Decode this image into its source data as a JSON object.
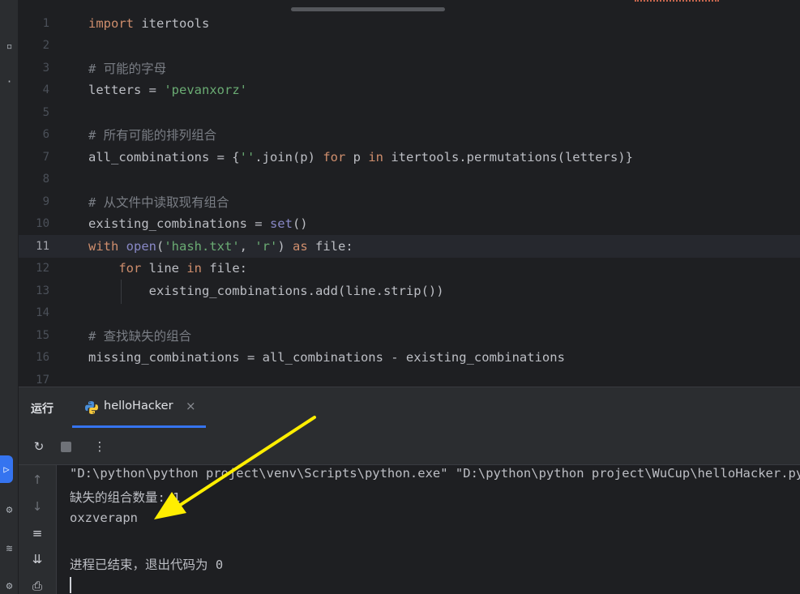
{
  "editor": {
    "lines": [
      {
        "n": "1",
        "segs": [
          {
            "c": "kw",
            "t": "import"
          },
          {
            "c": "",
            "t": " itertools"
          }
        ]
      },
      {
        "n": "2",
        "segs": []
      },
      {
        "n": "3",
        "segs": [
          {
            "c": "cmt",
            "t": "# 可能的字母"
          }
        ]
      },
      {
        "n": "4",
        "segs": [
          {
            "c": "",
            "t": "letters = "
          },
          {
            "c": "str",
            "t": "'pevanxorz'"
          }
        ]
      },
      {
        "n": "5",
        "segs": []
      },
      {
        "n": "6",
        "segs": [
          {
            "c": "cmt",
            "t": "# 所有可能的排列组合"
          }
        ]
      },
      {
        "n": "7",
        "segs": [
          {
            "c": "",
            "t": "all_combinations = {"
          },
          {
            "c": "str",
            "t": "''"
          },
          {
            "c": "",
            "t": ".join(p) "
          },
          {
            "c": "kw",
            "t": "for"
          },
          {
            "c": "",
            "t": " p "
          },
          {
            "c": "kw",
            "t": "in"
          },
          {
            "c": "",
            "t": " itertools.permutations(letters)}"
          }
        ]
      },
      {
        "n": "8",
        "segs": []
      },
      {
        "n": "9",
        "segs": [
          {
            "c": "cmt",
            "t": "# 从文件中读取现有组合"
          }
        ]
      },
      {
        "n": "10",
        "segs": [
          {
            "c": "",
            "t": "existing_combinations = "
          },
          {
            "c": "bi",
            "t": "set"
          },
          {
            "c": "",
            "t": "()"
          }
        ]
      },
      {
        "n": "11",
        "segs": [
          {
            "c": "kw",
            "t": "with"
          },
          {
            "c": "",
            "t": " "
          },
          {
            "c": "bi",
            "t": "open"
          },
          {
            "c": "",
            "t": "("
          },
          {
            "c": "str",
            "t": "'hash.txt'"
          },
          {
            "c": "",
            "t": ", "
          },
          {
            "c": "str",
            "t": "'r'"
          },
          {
            "c": "",
            "t": ") "
          },
          {
            "c": "kw",
            "t": "as"
          },
          {
            "c": "",
            "t": " file:"
          }
        ]
      },
      {
        "n": "12",
        "segs": [
          {
            "c": "",
            "t": "    "
          },
          {
            "c": "kw",
            "t": "for"
          },
          {
            "c": "",
            "t": " line "
          },
          {
            "c": "kw",
            "t": "in"
          },
          {
            "c": "",
            "t": " file:"
          }
        ]
      },
      {
        "n": "13",
        "segs": [
          {
            "c": "",
            "t": "        existing_combinations.add(line.strip())"
          }
        ]
      },
      {
        "n": "14",
        "segs": []
      },
      {
        "n": "15",
        "segs": [
          {
            "c": "cmt",
            "t": "# 查找缺失的组合"
          }
        ]
      },
      {
        "n": "16",
        "segs": [
          {
            "c": "",
            "t": "missing_combinations = all_combinations - existing_combinations"
          }
        ]
      },
      {
        "n": "17",
        "segs": []
      }
    ],
    "current_line": "11"
  },
  "run_panel": {
    "title": "运行",
    "tab_label": "helloHacker",
    "tab_close": "×",
    "more_icon": "⋮",
    "output": [
      "\"D:\\python\\python project\\venv\\Scripts\\python.exe\" \"D:\\python\\python project\\WuCup\\helloHacker.py\"",
      "缺失的组合数量: 1",
      "oxzverapn",
      "",
      "进程已结束，退出代码为 0"
    ]
  },
  "colors": {
    "accent": "#3574f0",
    "arrow": "#ffee00",
    "keyword": "#cf8e6d",
    "string": "#6aab73",
    "comment": "#7a7e85"
  }
}
